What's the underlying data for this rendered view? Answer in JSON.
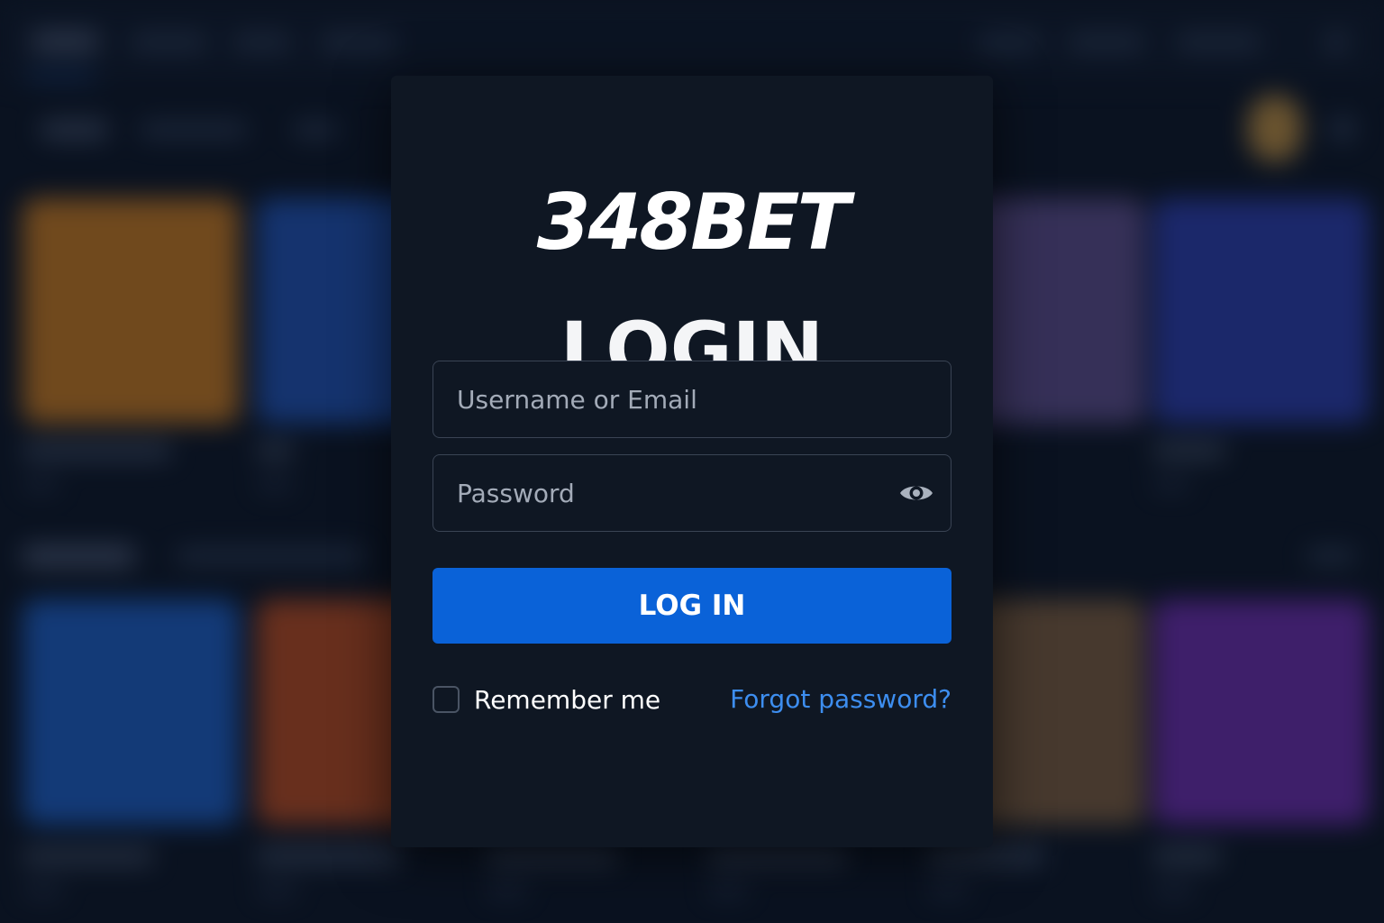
{
  "brand": {
    "name": "348BET"
  },
  "login_form": {
    "title": "LOGIN",
    "username": {
      "placeholder": "Username or Email",
      "value": ""
    },
    "password": {
      "placeholder": "Password",
      "value": "",
      "toggle_icon": "eye-icon"
    },
    "submit_label": "LOG IN",
    "remember": {
      "label": "Remember me",
      "checked": false
    },
    "forgot_label": "Forgot password?"
  },
  "colors": {
    "modal_background": "#0f1723",
    "primary_button": "#0a62d8",
    "link": "#3d8ef0",
    "text": "#ffffff",
    "placeholder": "#a3abb8",
    "field_border": "#3a4454"
  }
}
